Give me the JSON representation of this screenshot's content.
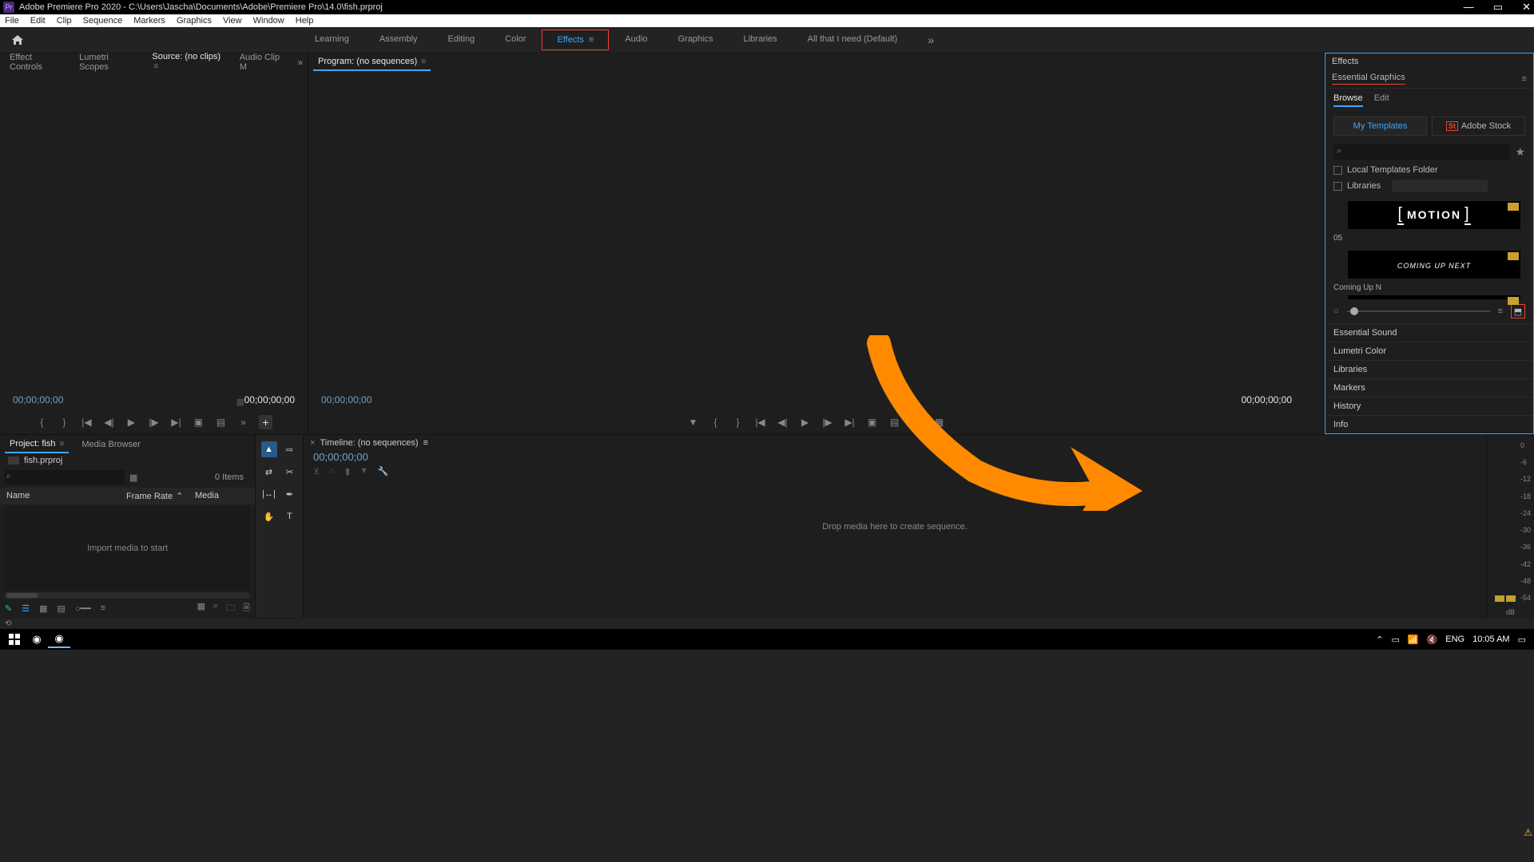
{
  "titlebar": {
    "appicon": "Pr",
    "title": "Adobe Premiere Pro 2020 - C:\\Users\\Jascha\\Documents\\Adobe\\Premiere Pro\\14.0\\fish.prproj"
  },
  "menubar": [
    "File",
    "Edit",
    "Clip",
    "Sequence",
    "Markers",
    "Graphics",
    "View",
    "Window",
    "Help"
  ],
  "workspaces": {
    "items": [
      "Learning",
      "Assembly",
      "Editing",
      "Color",
      "Effects",
      "Audio",
      "Graphics",
      "Libraries",
      "All that I need (Default)"
    ],
    "active": 4
  },
  "sourcePanel": {
    "tabs": [
      "Effect Controls",
      "Lumetri Scopes",
      "Source: (no clips)",
      "Audio Clip M"
    ],
    "active": 2,
    "tcLeft": "00;00;00;00",
    "tcRight": "00;00;00;00"
  },
  "programPanel": {
    "tab": "Program: (no sequences)",
    "tcLeft": "00;00;00;00",
    "tcRight": "00;00;00;00"
  },
  "projectPanel": {
    "tabs": [
      "Project: fish",
      "Media Browser"
    ],
    "active": 0,
    "file": "fish.prproj",
    "itemsLabel": "0 Items",
    "cols": [
      "Name",
      "Frame Rate",
      "Media"
    ],
    "empty": "Import media to start"
  },
  "timeline": {
    "tab": "Timeline: (no sequences)",
    "tc": "00;00;00;00",
    "drop": "Drop media here to create sequence."
  },
  "audio": {
    "scale": [
      "0",
      "-6",
      "-12",
      "-18",
      "-24",
      "-30",
      "-36",
      "-42",
      "-48",
      "-54"
    ],
    "unit": "dB"
  },
  "rightPanel": {
    "effectsTab": "Effects",
    "title": "Essential Graphics",
    "tabs": [
      "Browse",
      "Edit"
    ],
    "activeTab": 0,
    "cats": [
      "My Templates",
      "Adobe Stock"
    ],
    "activeCat": 0,
    "checks": [
      "Local Templates Folder",
      "Libraries"
    ],
    "thumb1_caption": "05",
    "thumb1_text": "MOTION",
    "thumb2_text": "COMING UP NEXT",
    "thumb2_caption": "Coming Up N",
    "extras": [
      "Essential Sound",
      "Lumetri Color",
      "Libraries",
      "Markers",
      "History",
      "Info"
    ]
  },
  "taskbar": {
    "lang": "ENG",
    "time": "10:05 AM"
  }
}
